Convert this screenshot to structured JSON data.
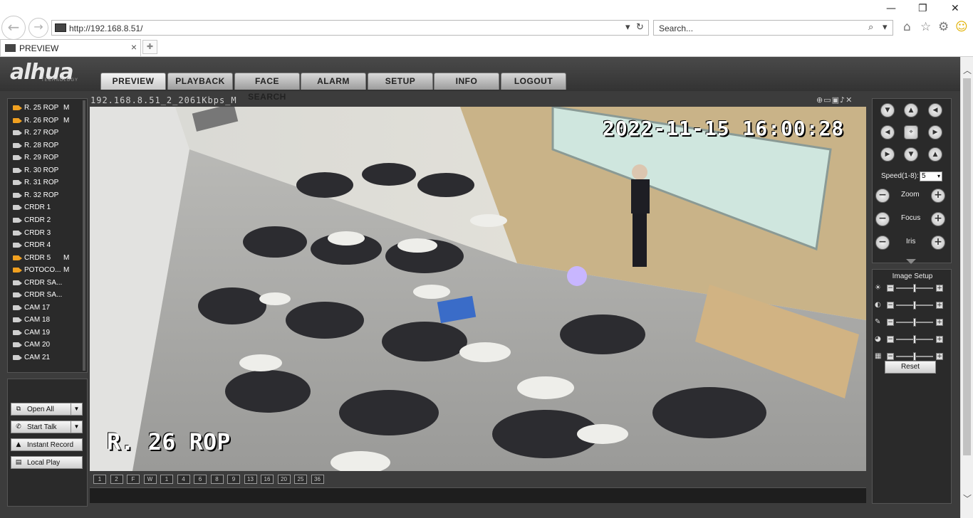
{
  "browser": {
    "url": "http://192.168.8.51/",
    "search_placeholder": "Search...",
    "tab_title": "PREVIEW"
  },
  "nav": {
    "logo": "alhua",
    "logo_sub": "TECHNOLOGY",
    "tabs": [
      "PREVIEW",
      "PLAYBACK",
      "FACE SEARCH",
      "ALARM",
      "SETUP",
      "INFO",
      "LOGOUT"
    ],
    "active": "PREVIEW"
  },
  "channels": [
    {
      "name": "R. 25 ROP",
      "flag": "M",
      "recording": true
    },
    {
      "name": "R. 26 ROP",
      "flag": "M",
      "recording": true
    },
    {
      "name": "R. 27 ROP",
      "flag": "",
      "recording": false
    },
    {
      "name": "R. 28 ROP",
      "flag": "",
      "recording": false
    },
    {
      "name": "R. 29 ROP",
      "flag": "",
      "recording": false
    },
    {
      "name": "R. 30 ROP",
      "flag": "",
      "recording": false
    },
    {
      "name": "R. 31 ROP",
      "flag": "",
      "recording": false
    },
    {
      "name": "R. 32 ROP",
      "flag": "",
      "recording": false
    },
    {
      "name": "CRDR 1",
      "flag": "",
      "recording": false
    },
    {
      "name": "CRDR 2",
      "flag": "",
      "recording": false
    },
    {
      "name": "CRDR 3",
      "flag": "",
      "recording": false
    },
    {
      "name": "CRDR 4",
      "flag": "",
      "recording": false
    },
    {
      "name": "CRDR 5",
      "flag": "M",
      "recording": true
    },
    {
      "name": "POTOCO...",
      "flag": "M",
      "recording": true
    },
    {
      "name": "CRDR SA...",
      "flag": "",
      "recording": false
    },
    {
      "name": "CRDR SA...",
      "flag": "",
      "recording": false
    },
    {
      "name": "CAM 17",
      "flag": "",
      "recording": false
    },
    {
      "name": "CAM 18",
      "flag": "",
      "recording": false
    },
    {
      "name": "CAM 19",
      "flag": "",
      "recording": false
    },
    {
      "name": "CAM 20",
      "flag": "",
      "recording": false
    },
    {
      "name": "CAM 21",
      "flag": "",
      "recording": false
    }
  ],
  "left_buttons": {
    "open_all": "Open All",
    "start_talk": "Start Talk",
    "instant_record": "Instant Record",
    "local_play": "Local Play"
  },
  "video": {
    "stream_title": "192.168.8.51_2_2061Kbps_M",
    "osd_timestamp": "2022-11-15 16:00:28",
    "osd_channel": "R. 26 ROP"
  },
  "split_buttons": [
    "1",
    "2",
    "F",
    "W",
    "1",
    "4",
    "6",
    "8",
    "9",
    "13",
    "16",
    "20",
    "25",
    "36"
  ],
  "ptz": {
    "speed_label": "Speed(1-8):",
    "speed_value": "5",
    "zoom_label": "Zoom",
    "focus_label": "Focus",
    "iris_label": "Iris"
  },
  "image_setup": {
    "title": "Image Setup",
    "sliders": [
      {
        "icon": "brightness-icon",
        "level": 0.5
      },
      {
        "icon": "contrast-icon",
        "level": 0.5
      },
      {
        "icon": "saturation-icon",
        "level": 0.5
      },
      {
        "icon": "hue-icon",
        "level": 0.5
      },
      {
        "icon": "sharpness-icon",
        "level": 0.5
      }
    ],
    "reset_label": "Reset"
  },
  "colors": {
    "recording_icon": "#f0a020",
    "panel_bg": "#2a2a2a",
    "page_bg": "#3c3c3c"
  }
}
